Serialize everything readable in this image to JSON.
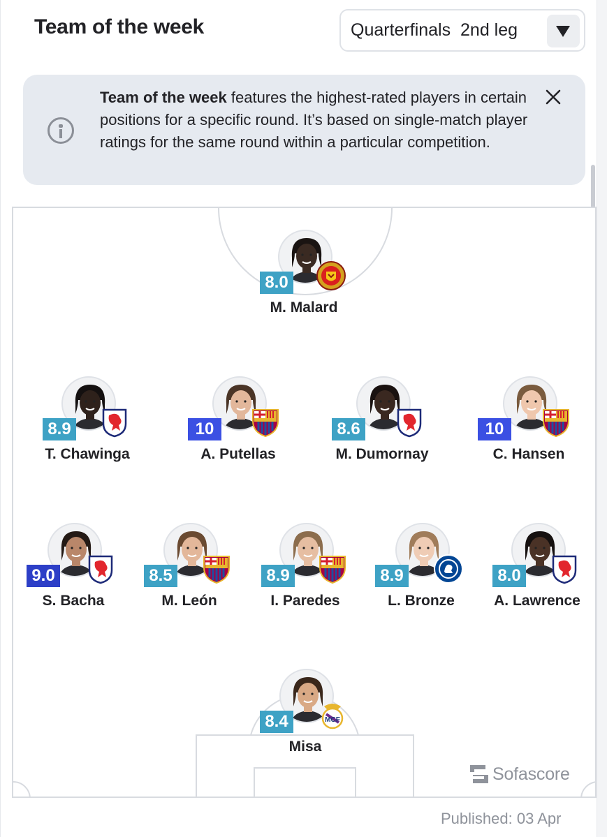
{
  "header": {
    "title": "Team of the week",
    "round_select": {
      "label": "Quarterfinals  2nd leg"
    }
  },
  "info": {
    "bold": "Team of the week",
    "text": " features the highest-rated players in certain positions for a specific round. It’s based on single-match player ratings for the same round within a particular competition."
  },
  "colors": {
    "rating_teal": "#3ea2c5",
    "rating_blue": "#3b50e3",
    "rating_navy": "#2d3fc7"
  },
  "players": [
    {
      "name": "M. Malard",
      "rating": "8.0",
      "club": "manchester-united-crest-icon",
      "rating_style": "teal",
      "skin": "#3a2a22",
      "hair": "#1a1412"
    },
    {
      "name": "T. Chawinga",
      "rating": "8.9",
      "club": "ol-lyonnes-crest-icon",
      "rating_style": "teal",
      "skin": "#2e211b",
      "hair": "#141010"
    },
    {
      "name": "A. Putellas",
      "rating": "10",
      "club": "fc-barcelona-crest-icon",
      "rating_style": "blue",
      "skin": "#e2b79b",
      "hair": "#4a3426"
    },
    {
      "name": "M. Dumornay",
      "rating": "8.6",
      "club": "ol-lyonnes-crest-icon",
      "rating_style": "teal",
      "skin": "#3a2820",
      "hair": "#1a1210"
    },
    {
      "name": "C. Hansen",
      "rating": "10",
      "club": "fc-barcelona-crest-icon",
      "rating_style": "blue",
      "skin": "#efc7ad",
      "hair": "#7a5b3e"
    },
    {
      "name": "S. Bacha",
      "rating": "9.0",
      "club": "ol-lyonnes-crest-icon",
      "rating_style": "navy",
      "skin": "#b9876a",
      "hair": "#241a15"
    },
    {
      "name": "M. León",
      "rating": "8.5",
      "club": "fc-barcelona-crest-icon",
      "rating_style": "teal",
      "skin": "#e3b79a",
      "hair": "#6a4a31"
    },
    {
      "name": "I. Paredes",
      "rating": "8.9",
      "club": "fc-barcelona-crest-icon",
      "rating_style": "teal",
      "skin": "#e6bea2",
      "hair": "#8c6d4d"
    },
    {
      "name": "L. Bronze",
      "rating": "8.9",
      "club": "chelsea-crest-icon",
      "rating_style": "teal",
      "skin": "#efccb5",
      "hair": "#a07c5a"
    },
    {
      "name": "A. Lawrence",
      "rating": "8.0",
      "club": "ol-lyonnes-crest-icon",
      "rating_style": "teal",
      "skin": "#4a3226",
      "hair": "#161110"
    },
    {
      "name": "Misa",
      "rating": "8.4",
      "club": "real-madrid-crest-icon",
      "rating_style": "teal",
      "skin": "#d9a985",
      "hair": "#3a271b"
    }
  ],
  "brand": {
    "name": "Sofascore"
  },
  "footer": {
    "published": "Published: 03 Apr"
  }
}
